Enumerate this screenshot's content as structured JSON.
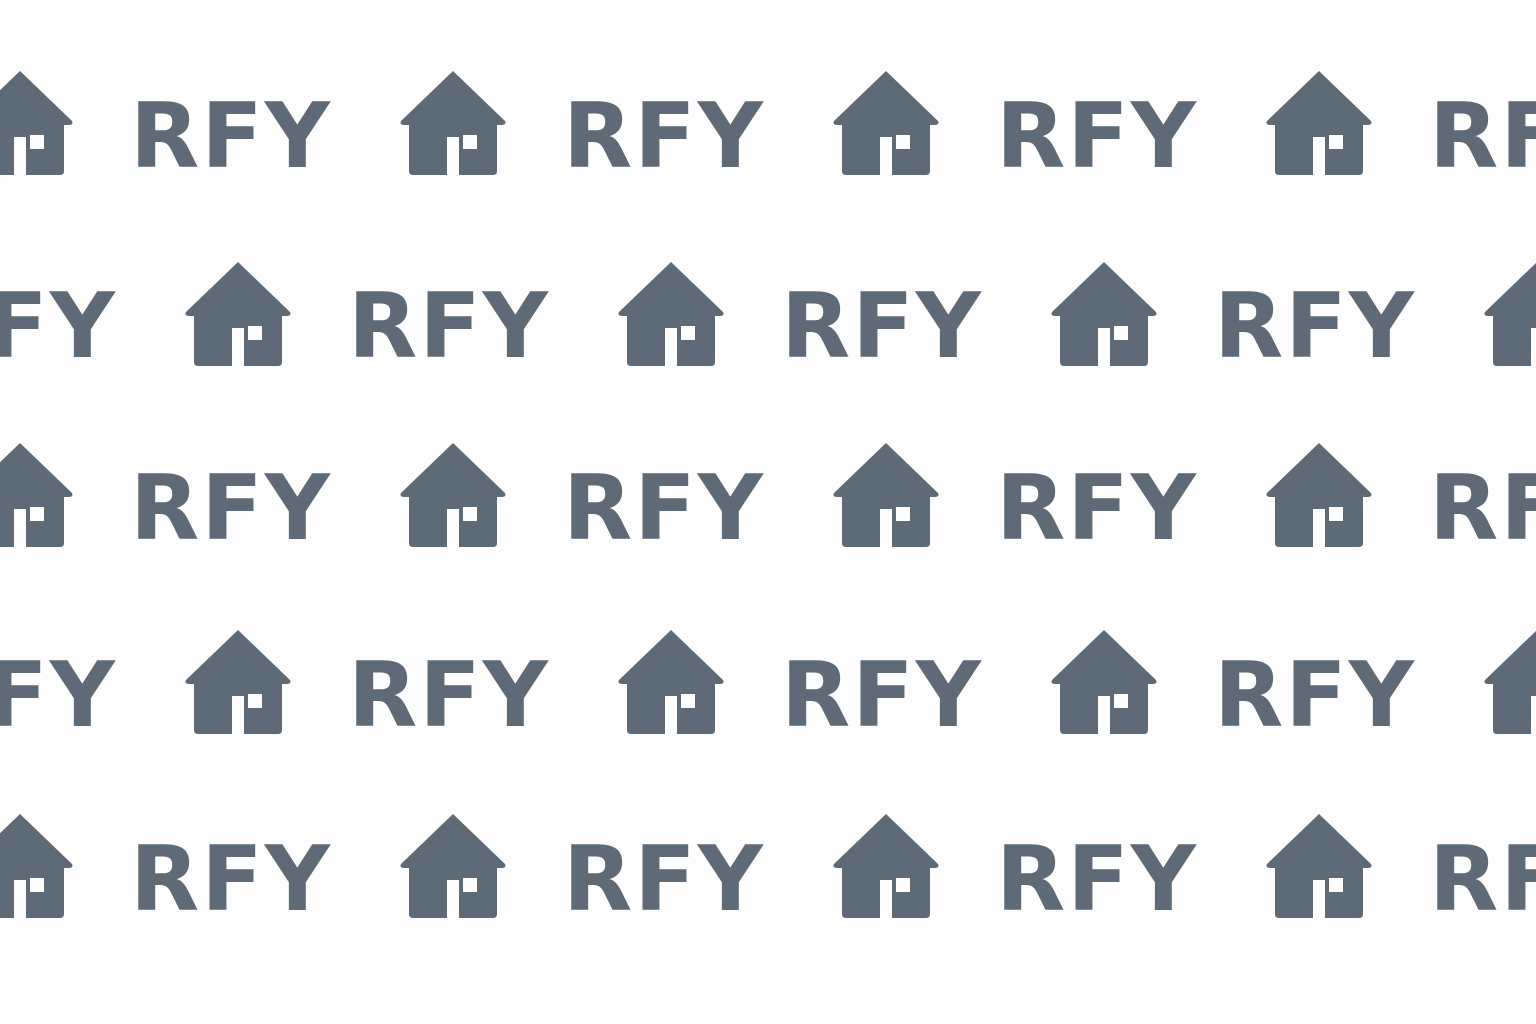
{
  "pattern": {
    "label": "RFY",
    "icon": "house-icon",
    "color": "#5f6a77",
    "background": "#fdfdfd",
    "rows": 5,
    "row_offset_alternates": true
  }
}
